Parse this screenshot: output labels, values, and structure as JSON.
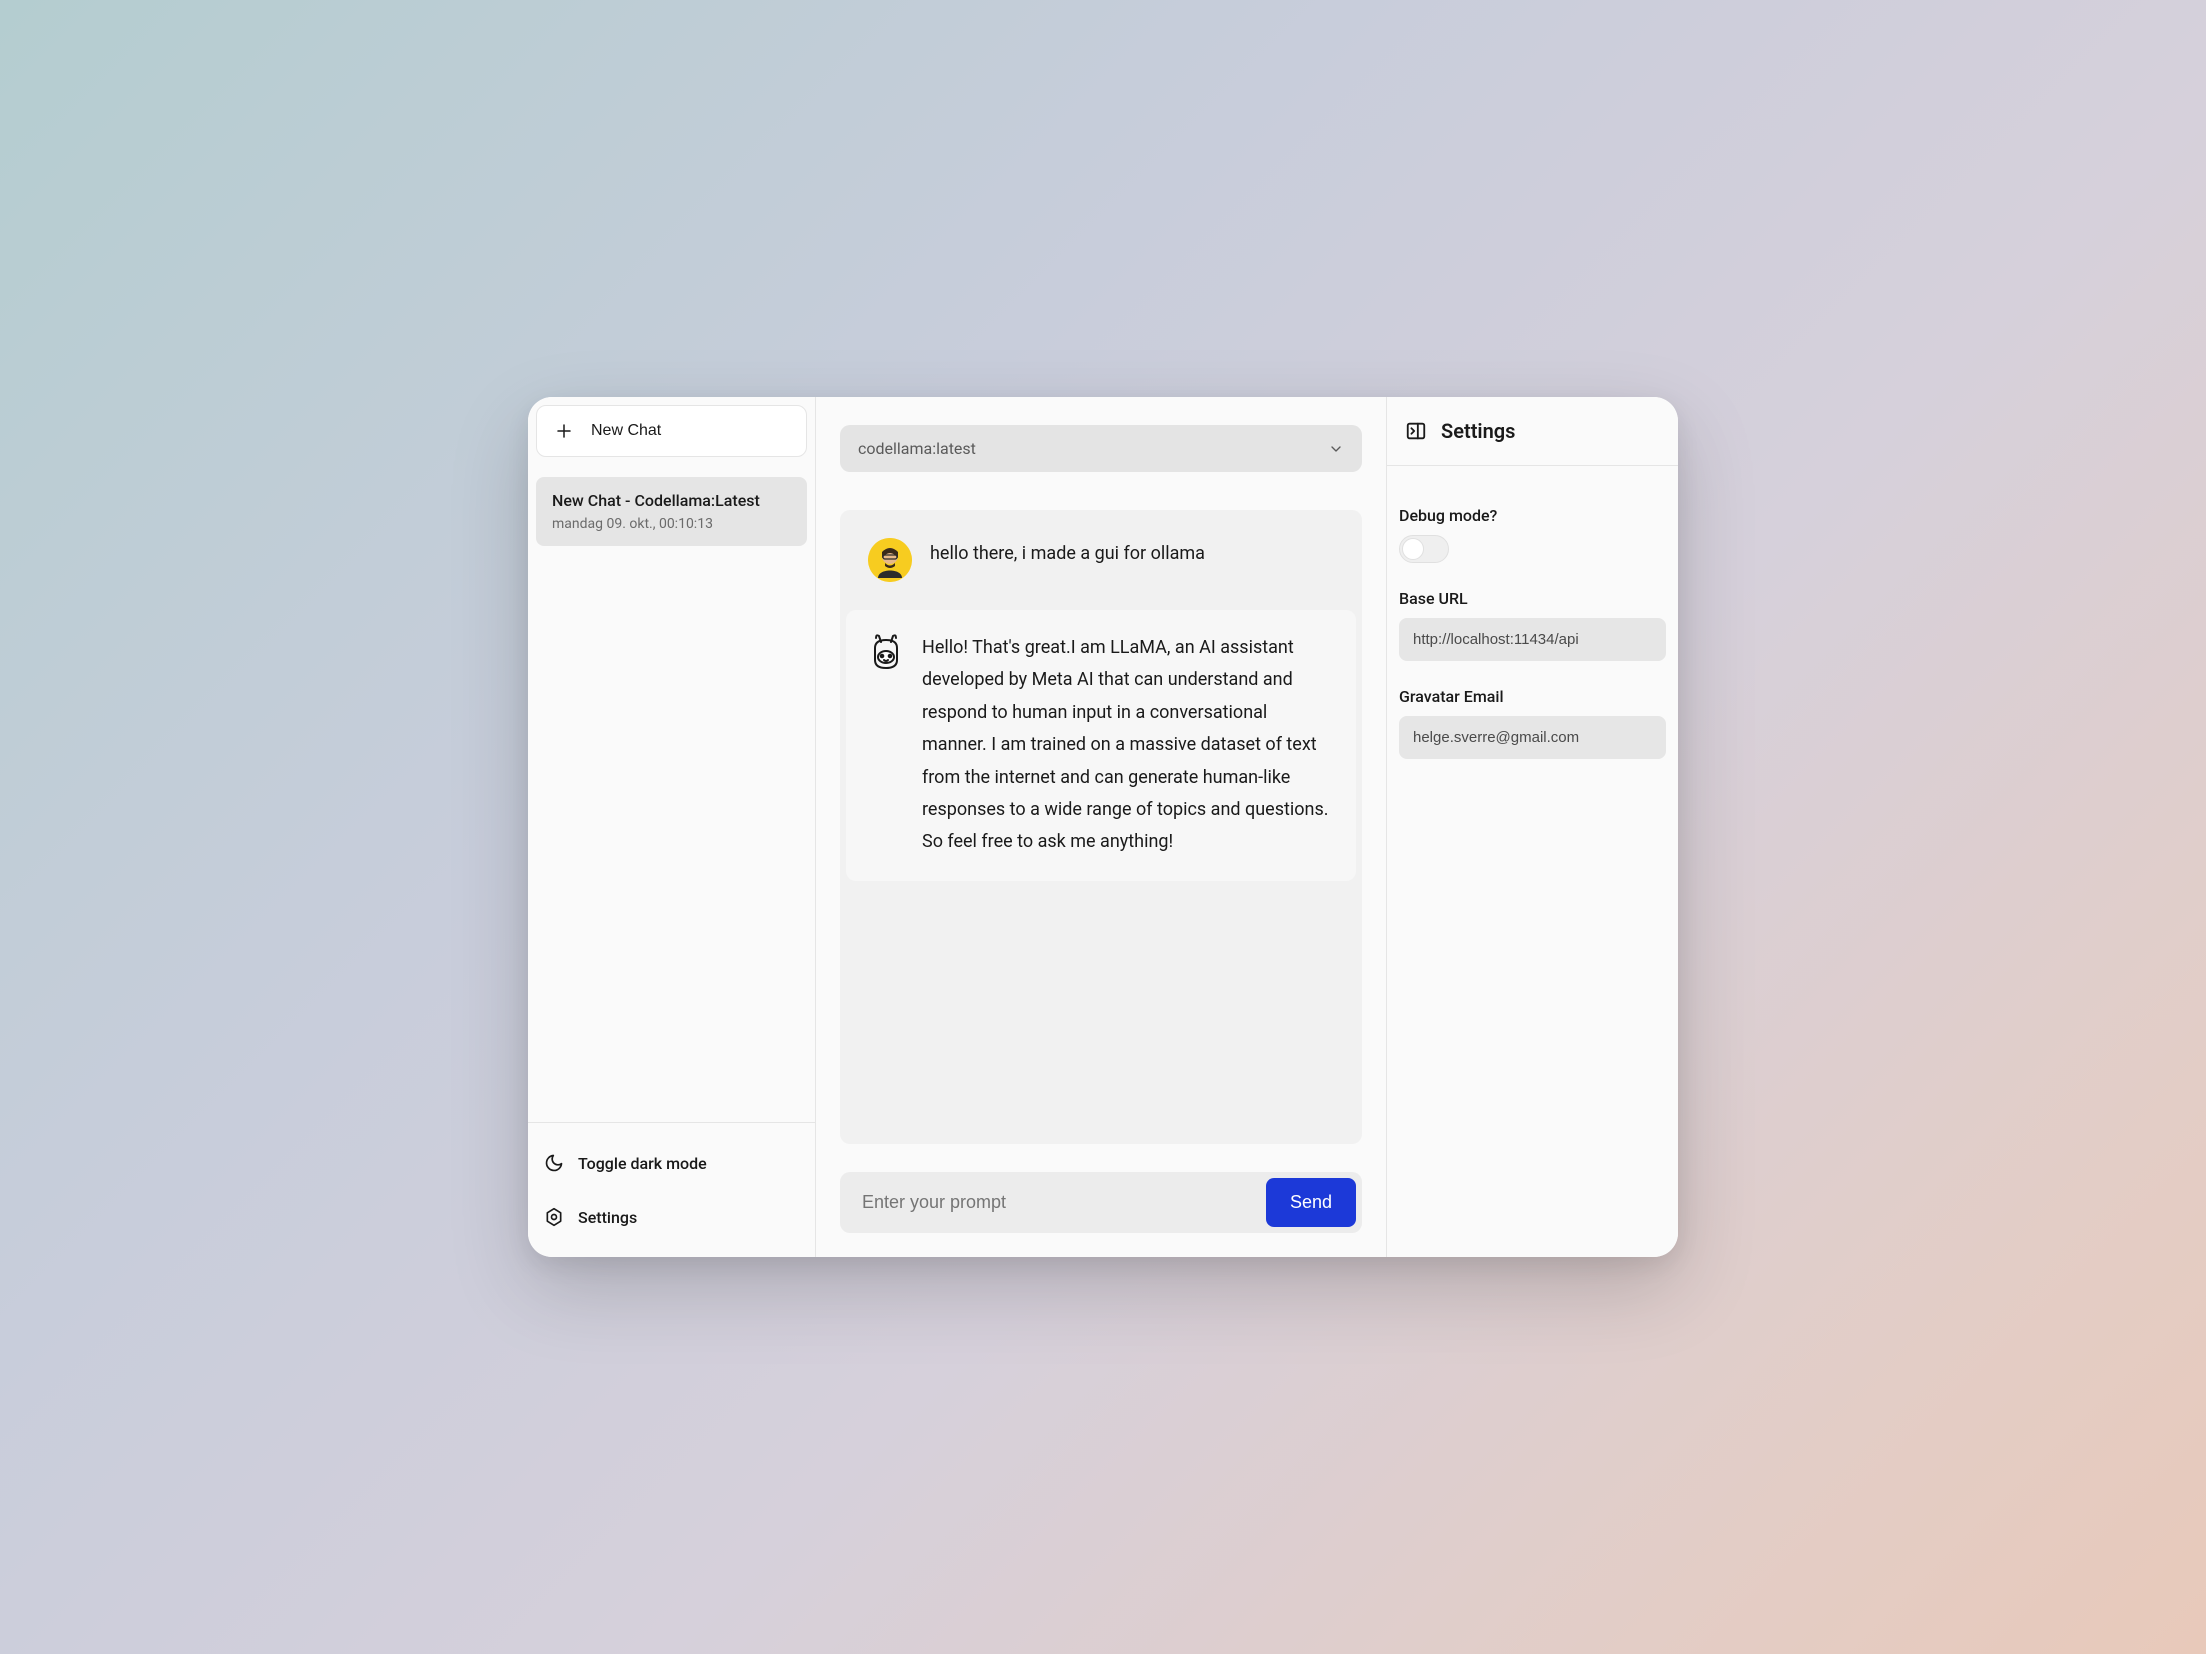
{
  "sidebar": {
    "new_chat": "New Chat",
    "chats": [
      {
        "title": "New Chat - Codellama:Latest",
        "timestamp": "mandag 09. okt., 00:10:13"
      }
    ],
    "toggle_dark": "Toggle dark mode",
    "settings": "Settings"
  },
  "main": {
    "model_selected": "codellama:latest",
    "messages": [
      {
        "role": "user",
        "text": "hello there, i made a gui for ollama"
      },
      {
        "role": "assistant",
        "text": "Hello! That's great.I am LLaMA, an AI assistant developed by Meta AI that can understand and respond to human input in a conversational manner. I am trained on a massive dataset of text from the internet and can generate human-like responses to a wide range of topics and questions. So feel free to ask me anything!"
      }
    ],
    "prompt_placeholder": "Enter your prompt",
    "send_label": "Send"
  },
  "settings_panel": {
    "title": "Settings",
    "debug_label": "Debug mode?",
    "debug_on": false,
    "base_url_label": "Base URL",
    "base_url_value": "http://localhost:11434/api",
    "gravatar_label": "Gravatar Email",
    "gravatar_value": "helge.sverre@gmail.com"
  }
}
